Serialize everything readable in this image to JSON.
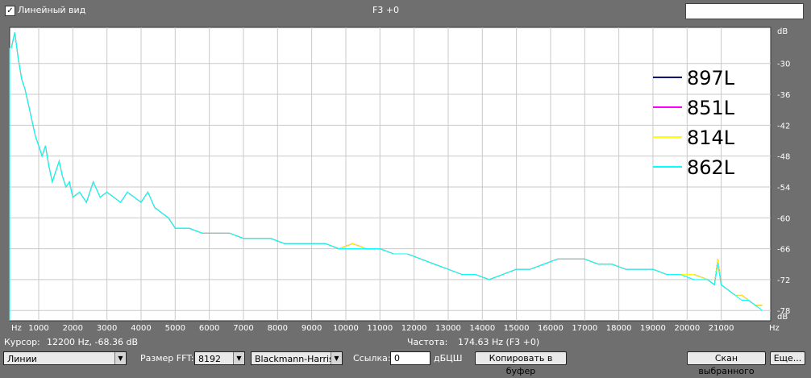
{
  "header": {
    "linear_view_checked": true,
    "linear_view_label": "Линейный вид",
    "title": "F3 +0"
  },
  "chart_data": {
    "type": "line",
    "x_unit_label": "Hz",
    "y_unit_label": "dB",
    "xlim": [
      150,
      22450
    ],
    "ylim": [
      -80,
      -23
    ],
    "x_ticks": [
      1000,
      2000,
      3000,
      4000,
      5000,
      6000,
      7000,
      8000,
      9000,
      10000,
      11000,
      12000,
      13000,
      14000,
      15000,
      16000,
      17000,
      18000,
      19000,
      20000,
      21000
    ],
    "y_ticks": [
      -30,
      -36,
      -42,
      -48,
      -54,
      -60,
      -66,
      -72,
      -78
    ],
    "grid": true,
    "legend_position": "top-right",
    "series": [
      {
        "name": "897L",
        "color": "#000080",
        "x": [
          200,
          300,
          400,
          500,
          600,
          700,
          800,
          900,
          1000,
          1100,
          1200,
          1300,
          1400,
          1500,
          1600,
          1700,
          1800,
          1900,
          2000,
          2200,
          2400,
          2600,
          2800,
          3000,
          3200,
          3400,
          3600,
          3800,
          4000,
          4200,
          4400,
          4600,
          4800,
          5000,
          5400,
          5800,
          6200,
          6600,
          7000,
          7400,
          7800,
          8200,
          8600,
          9000,
          9400,
          9800,
          10200,
          10600,
          11000,
          11400,
          11800,
          12200,
          12600,
          13000,
          13400,
          13800,
          14200,
          14600,
          15000,
          15400,
          15800,
          16200,
          16600,
          17000,
          17400,
          17800,
          18200,
          18600,
          19000,
          19400,
          19800,
          20200,
          20600,
          20800,
          20900,
          21000,
          21200,
          21400,
          21600,
          21800,
          22000,
          22200
        ],
        "values": [
          -27,
          -24,
          -29,
          -33,
          -35,
          -38,
          -41,
          -44,
          -46,
          -48,
          -46,
          -50,
          -53,
          -51,
          -49,
          -52,
          -54,
          -53,
          -56,
          -55,
          -57,
          -53,
          -56,
          -55,
          -56,
          -57,
          -55,
          -56,
          -57,
          -55,
          -58,
          -59,
          -60,
          -62,
          -62,
          -63,
          -63,
          -63,
          -64,
          -64,
          -64,
          -65,
          -65,
          -65,
          -65,
          -66,
          -65,
          -66,
          -66,
          -67,
          -67,
          -68,
          -69,
          -70,
          -71,
          -71,
          -72,
          -71,
          -70,
          -70,
          -69,
          -68,
          -68,
          -68,
          -69,
          -69,
          -70,
          -70,
          -70,
          -71,
          -71,
          -71,
          -72,
          -73,
          -68,
          -73,
          -74,
          -75,
          -75,
          -76,
          -77,
          -77
        ]
      },
      {
        "name": "851L",
        "color": "#ff00ff",
        "x": [
          200,
          300,
          400,
          500,
          600,
          700,
          800,
          900,
          1000,
          1100,
          1200,
          1300,
          1400,
          1500,
          1600,
          1700,
          1800,
          1900,
          2000,
          2200,
          2400,
          2600,
          2800,
          3000,
          3200,
          3400,
          3600,
          3800,
          4000,
          4200,
          4400,
          4600,
          4800,
          5000,
          5400,
          5800,
          6200,
          6600,
          7000,
          7400,
          7800,
          8200,
          8600,
          9000,
          9400,
          9800,
          10200,
          10600,
          11000,
          11400,
          11800,
          12200,
          12600,
          13000,
          13400,
          13800,
          14200,
          14600,
          15000,
          15400,
          15800,
          16200,
          16600,
          17000,
          17400,
          17800,
          18200,
          18600,
          19000,
          19400,
          19800,
          20200,
          20600,
          20800,
          20900,
          21000,
          21200,
          21400,
          21600,
          21800,
          22000,
          22200
        ],
        "values": [
          -27,
          -24,
          -29,
          -33,
          -35,
          -38,
          -41,
          -44,
          -46,
          -48,
          -46,
          -50,
          -53,
          -51,
          -49,
          -52,
          -54,
          -53,
          -56,
          -55,
          -57,
          -53,
          -56,
          -55,
          -56,
          -57,
          -55,
          -56,
          -57,
          -55,
          -58,
          -59,
          -60,
          -62,
          -62,
          -63,
          -63,
          -63,
          -64,
          -64,
          -64,
          -65,
          -65,
          -65,
          -65,
          -66,
          -65,
          -66,
          -66,
          -67,
          -67,
          -68,
          -69,
          -70,
          -71,
          -71,
          -72,
          -71,
          -70,
          -70,
          -69,
          -68,
          -68,
          -68,
          -69,
          -69,
          -70,
          -70,
          -70,
          -71,
          -71,
          -71,
          -72,
          -73,
          -68,
          -73,
          -74,
          -75,
          -75,
          -76,
          -77,
          -77
        ]
      },
      {
        "name": "814L",
        "color": "#ffff00",
        "x": [
          200,
          300,
          400,
          500,
          600,
          700,
          800,
          900,
          1000,
          1100,
          1200,
          1300,
          1400,
          1500,
          1600,
          1700,
          1800,
          1900,
          2000,
          2200,
          2400,
          2600,
          2800,
          3000,
          3200,
          3400,
          3600,
          3800,
          4000,
          4200,
          4400,
          4600,
          4800,
          5000,
          5400,
          5800,
          6200,
          6600,
          7000,
          7400,
          7800,
          8200,
          8600,
          9000,
          9400,
          9800,
          10200,
          10600,
          11000,
          11400,
          11800,
          12200,
          12600,
          13000,
          13400,
          13800,
          14200,
          14600,
          15000,
          15400,
          15800,
          16200,
          16600,
          17000,
          17400,
          17800,
          18200,
          18600,
          19000,
          19400,
          19800,
          20200,
          20600,
          20800,
          20900,
          21000,
          21200,
          21400,
          21600,
          21800,
          22000,
          22200
        ],
        "values": [
          -27,
          -24,
          -29,
          -33,
          -35,
          -38,
          -41,
          -44,
          -46,
          -48,
          -46,
          -50,
          -53,
          -51,
          -49,
          -52,
          -54,
          -53,
          -56,
          -55,
          -57,
          -53,
          -56,
          -55,
          -56,
          -57,
          -55,
          -56,
          -57,
          -55,
          -58,
          -59,
          -60,
          -62,
          -62,
          -63,
          -63,
          -63,
          -64,
          -64,
          -64,
          -65,
          -65,
          -65,
          -65,
          -66,
          -65,
          -66,
          -66,
          -67,
          -67,
          -68,
          -69,
          -70,
          -71,
          -71,
          -72,
          -71,
          -70,
          -70,
          -69,
          -68,
          -68,
          -68,
          -69,
          -69,
          -70,
          -70,
          -70,
          -71,
          -71,
          -71,
          -72,
          -73,
          -68,
          -73,
          -74,
          -75,
          -75,
          -76,
          -77,
          -77
        ]
      },
      {
        "name": "862L",
        "color": "#00ffff",
        "x": [
          200,
          300,
          400,
          500,
          600,
          700,
          800,
          900,
          1000,
          1100,
          1200,
          1300,
          1400,
          1500,
          1600,
          1700,
          1800,
          1900,
          2000,
          2200,
          2400,
          2600,
          2800,
          3000,
          3200,
          3400,
          3600,
          3800,
          4000,
          4200,
          4400,
          4600,
          4800,
          5000,
          5400,
          5800,
          6200,
          6600,
          7000,
          7400,
          7800,
          8200,
          8600,
          9000,
          9400,
          9800,
          10200,
          10600,
          11000,
          11400,
          11800,
          12200,
          12600,
          13000,
          13400,
          13800,
          14200,
          14600,
          15000,
          15400,
          15800,
          16200,
          16600,
          17000,
          17400,
          17800,
          18200,
          18600,
          19000,
          19400,
          19800,
          20200,
          20600,
          20800,
          20900,
          21000,
          21200,
          21400,
          21600,
          21800,
          22000,
          22200
        ],
        "values": [
          -27,
          -24,
          -29,
          -33,
          -35,
          -38,
          -41,
          -44,
          -46,
          -48,
          -46,
          -50,
          -53,
          -51,
          -49,
          -52,
          -54,
          -53,
          -56,
          -55,
          -57,
          -53,
          -56,
          -55,
          -56,
          -57,
          -55,
          -56,
          -57,
          -55,
          -58,
          -59,
          -60,
          -62,
          -62,
          -63,
          -63,
          -63,
          -64,
          -64,
          -64,
          -65,
          -65,
          -65,
          -65,
          -66,
          -66,
          -66,
          -66,
          -67,
          -67,
          -68,
          -69,
          -70,
          -71,
          -71,
          -72,
          -71,
          -70,
          -70,
          -69,
          -68,
          -68,
          -68,
          -69,
          -69,
          -70,
          -70,
          -70,
          -71,
          -71,
          -72,
          -72,
          -73,
          -69,
          -73,
          -74,
          -75,
          -76,
          -76,
          -77,
          -78
        ]
      }
    ]
  },
  "status": {
    "cursor_label": "Курсор:",
    "cursor_value": "12200 Hz, -68.36 dB",
    "freq_label": "Частота:",
    "freq_value": "174.63 Hz (F3 +0)"
  },
  "controls": {
    "mode_select": "Линии",
    "fft_size_label": "Размер FFT:",
    "fft_size_value": "8192",
    "window_select": "Blackmann-Harris",
    "ref_label": "Ссылка:",
    "ref_value": "0",
    "ref_unit": "дБЦШ",
    "copy_button": "Копировать в буфер",
    "scan_button": "Скан выбранного",
    "more_button": "Еще..."
  }
}
